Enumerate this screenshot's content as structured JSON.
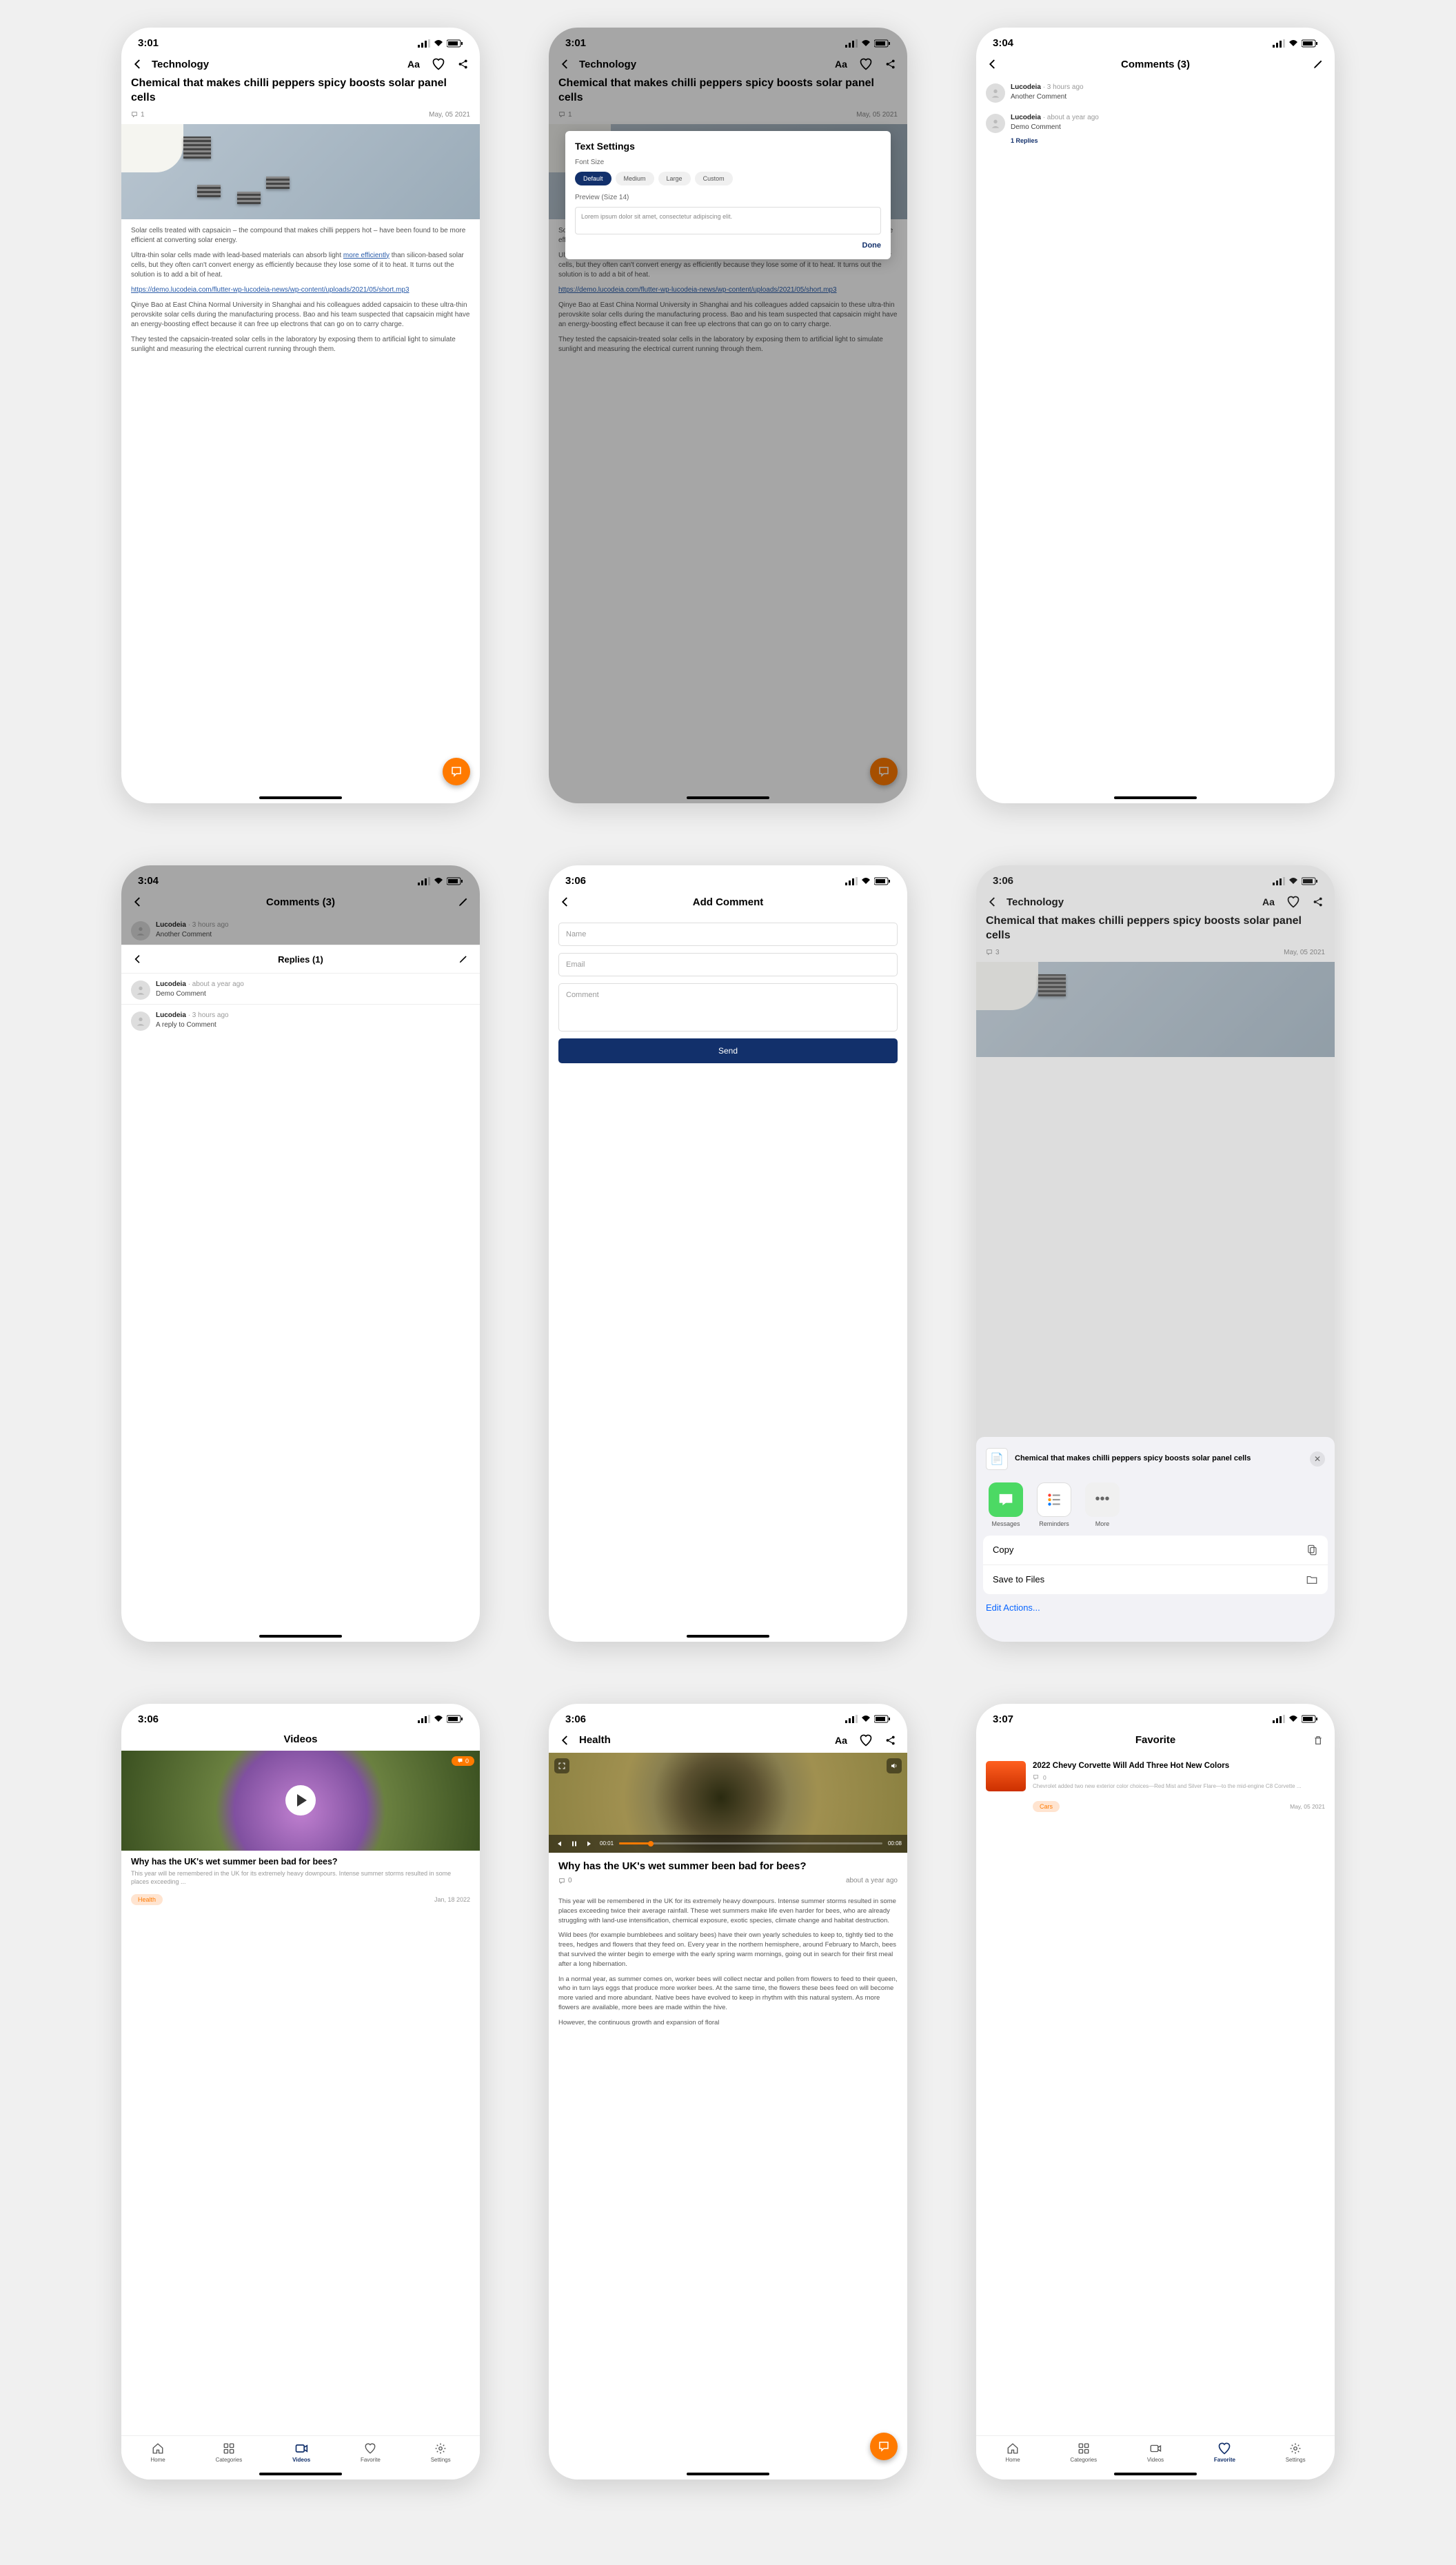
{
  "s1": {
    "time": "3:01",
    "header_title": "Technology",
    "article_title": "Chemical that makes chilli peppers spicy boosts solar panel cells",
    "comment_count": "1",
    "date": "May, 05 2021",
    "p1": "Solar cells treated with capsaicin – the compound that makes chilli peppers hot – have been found to be more efficient at converting solar energy.",
    "p2a": "Ultra-thin solar cells made with lead-based materials can absorb light ",
    "p2_link": "more efficiently",
    "p2b": " than silicon-based solar cells, but they often can't convert energy as efficiently because they lose some of it to heat. It turns out the solution is to add a bit of heat.",
    "url": "https://demo.lucodeia.com/flutter-wp-lucodeia-news/wp-content/uploads/2021/05/short.mp3",
    "p3": "Qinye Bao at East China Normal University in Shanghai and his colleagues added capsaicin to these ultra-thin perovskite solar cells during the manufacturing process. Bao and his team suspected that capsaicin might have an energy-boosting effect because it can free up electrons that can go on to carry charge.",
    "p4": "They tested the capsaicin-treated solar cells in the laboratory by exposing them to artificial light to simulate sunlight and measuring the electrical current running through them."
  },
  "s2": {
    "time": "3:01",
    "header_title": "Technology",
    "modal_title": "Text Settings",
    "font_size_label": "Font Size",
    "sizes": [
      "Default",
      "Medium",
      "Large",
      "Custom"
    ],
    "preview_label": "Preview (Size 14)",
    "preview_text": "Lorem ipsum dolor sit amet, consectetur adipiscing elit.",
    "done": "Done"
  },
  "s3": {
    "time": "3:04",
    "header_title": "Comments (3)",
    "c1_author": "Lucodeia",
    "c1_time": "· 3 hours ago",
    "c1_text": "Another Comment",
    "c2_author": "Lucodeia",
    "c2_time": "· about a year ago",
    "c2_text": "Demo Comment",
    "replies_link": "1 Replies"
  },
  "s4": {
    "time": "3:04",
    "header_title": "Comments (3)",
    "top_c_author": "Lucodeia",
    "top_c_time": "· 3 hours ago",
    "top_c_text": "Another Comment",
    "replies_title": "Replies (1)",
    "r1_author": "Lucodeia",
    "r1_time": "· about a year ago",
    "r1_text": "Demo Comment",
    "r2_author": "Lucodeia",
    "r2_time": "· 3 hours ago",
    "r2_text": "A reply to Comment"
  },
  "s5": {
    "time": "3:06",
    "header_title": "Add Comment",
    "name_ph": "Name",
    "email_ph": "Email",
    "comment_ph": "Comment",
    "send": "Send"
  },
  "s6": {
    "time": "3:06",
    "header_title": "Technology",
    "article_title": "Chemical that makes chilli peppers spicy boosts solar panel cells",
    "comment_count": "3",
    "date": "May, 05 2021",
    "share_title": "Chemical that makes chilli peppers spicy boosts solar panel cells",
    "app1": "Messages",
    "app2": "Reminders",
    "app3": "More",
    "action1": "Copy",
    "action2": "Save to Files",
    "edit": "Edit Actions..."
  },
  "s7": {
    "time": "3:06",
    "header_title": "Videos",
    "badge_count": "0",
    "title": "Why has the UK's wet summer been bad for bees?",
    "desc": "This year will be remembered in the UK for its extremely heavy downpours. Intense summer storms resulted in some places exceeding ...",
    "tag": "Health",
    "date": "Jan, 18 2022",
    "tabs": [
      "Home",
      "Categories",
      "Videos",
      "Favorite",
      "Settings"
    ]
  },
  "s8": {
    "time": "3:06",
    "header_title": "Health",
    "time_cur": "00:01",
    "time_tot": "00:08",
    "title": "Why has the UK's wet summer been bad for bees?",
    "comment_count": "0",
    "date": "about a year ago",
    "p1": "This year will be remembered in the UK for its extremely heavy downpours. Intense summer storms resulted in some places exceeding twice their average rainfall. These wet summers make life even harder for bees, who are already struggling with land-use intensification, chemical exposure, exotic species, climate change and habitat destruction.",
    "p2": "Wild bees (for example bumblebees and solitary bees) have their own yearly schedules to keep to, tightly tied to the trees, hedges and flowers that they feed on. Every year in the northern hemisphere, around February to March, bees that survived the winter begin to emerge with the early spring warm mornings, going out in search for their first meal after a long hibernation.",
    "p3": "In a normal year, as summer comes on, worker bees will collect nectar and pollen from flowers to feed to their queen, who in turn lays eggs that produce more worker bees. At the same time, the flowers these bees feed on will become more varied and more abundant. Native bees have evolved to keep in rhythm with this natural system. As more flowers are available, more bees are made within the hive.",
    "p4": "However, the continuous growth and expansion of floral"
  },
  "s9": {
    "time": "3:07",
    "header_title": "Favorite",
    "fav_title": "2022 Chevy Corvette Will Add Three Hot New Colors",
    "fav_count": "0",
    "fav_desc": "Chevrolet added two new exterior color choices—Red Mist and Silver Flare—to the mid-engine C8 Corvette ...",
    "fav_tag": "Cars",
    "fav_date": "May, 05 2021",
    "tabs": [
      "Home",
      "Categories",
      "Videos",
      "Favorite",
      "Settings"
    ]
  }
}
